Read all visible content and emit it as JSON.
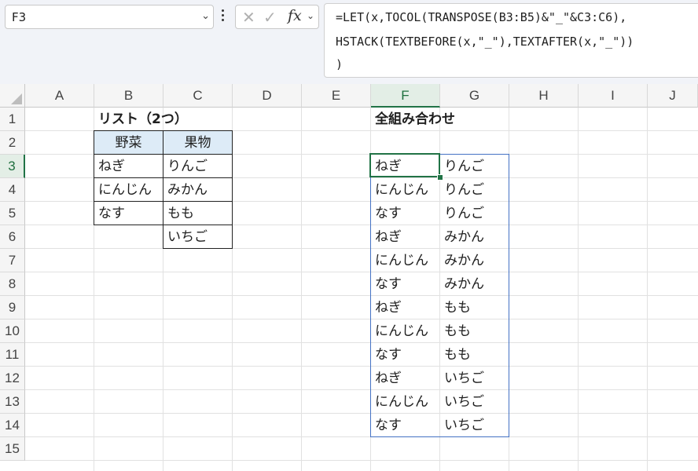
{
  "namebox": {
    "value": "F3"
  },
  "formula_bar": {
    "lines": [
      "=LET(x,TOCOL(TRANSPOSE(B3:B5)&\"_\"&C3:C6),",
      "HSTACK(TEXTBEFORE(x,\"_\"),TEXTAFTER(x,\"_\"))",
      ")"
    ],
    "fx_label": "fx"
  },
  "columns": [
    "A",
    "B",
    "C",
    "D",
    "E",
    "F",
    "G",
    "H",
    "I",
    "J"
  ],
  "rows": [
    "1",
    "2",
    "3",
    "4",
    "5",
    "6",
    "7",
    "8",
    "9",
    "10",
    "11",
    "12",
    "13",
    "14",
    "15"
  ],
  "colors": {
    "accent": "#217346",
    "header_fill": "#ddebf7",
    "spill_border": "#4472c4"
  },
  "list_table": {
    "title": "リスト（2つ）",
    "headers": [
      "野菜",
      "果物"
    ],
    "vegetables": [
      "ねぎ",
      "にんじん",
      "なす"
    ],
    "fruits": [
      "りんご",
      "みかん",
      "もも",
      "いちご"
    ]
  },
  "combinations": {
    "title": "全組み合わせ",
    "rows": [
      [
        "ねぎ",
        "りんご"
      ],
      [
        "にんじん",
        "りんご"
      ],
      [
        "なす",
        "りんご"
      ],
      [
        "ねぎ",
        "みかん"
      ],
      [
        "にんじん",
        "みかん"
      ],
      [
        "なす",
        "みかん"
      ],
      [
        "ねぎ",
        "もも"
      ],
      [
        "にんじん",
        "もも"
      ],
      [
        "なす",
        "もも"
      ],
      [
        "ねぎ",
        "いちご"
      ],
      [
        "にんじん",
        "いちご"
      ],
      [
        "なす",
        "いちご"
      ]
    ]
  }
}
